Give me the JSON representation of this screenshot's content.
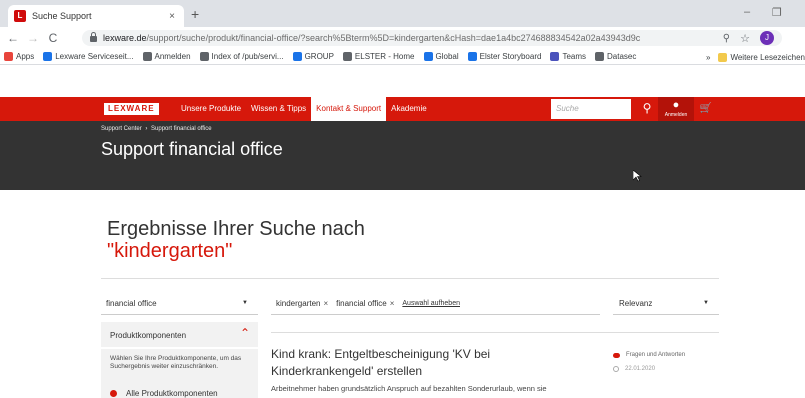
{
  "browser": {
    "tab_title": "Suche Support",
    "tab_close": "×",
    "new_tab": "+",
    "url_host": "lexware.de",
    "url_path": "/support/suche/produkt/financial-office/?search%5Bterm%5D=kindergarten&cHash=dae1a4bc274688834542a02a43943d9c",
    "profile_initial": "J",
    "bookmarks": [
      "Apps",
      "Lexware Serviceseit...",
      "Anmelden",
      "Index of /pub/servi...",
      "GROUP",
      "ELSTER - Home",
      "Global",
      "Elster Storyboard",
      "Teams",
      "Datasec"
    ],
    "bookmarks_more": "»",
    "bookmarks_other": "Weitere Lesezeichen",
    "bookmark_colors": [
      "#e8453c",
      "#1a73e8",
      "#5f6368",
      "#5f6368",
      "#1a73e8",
      "#5f6368",
      "#1a73e8",
      "#1a73e8",
      "#4b53bc",
      "#5f6368"
    ]
  },
  "nav": {
    "logo": "LEXWARE",
    "links": [
      "Unsere Produkte",
      "Wissen & Tipps",
      "Kontakt & Support",
      "Akademie"
    ],
    "active_index": 2,
    "search_placeholder": "Suche",
    "login_label": "Anmelden",
    "brand_color": "#d6180b"
  },
  "hero": {
    "breadcrumb": [
      "Support Center",
      "Support financial office"
    ],
    "breadcrumb_sep": "›",
    "title": "Support financial office"
  },
  "results": {
    "heading": "Ergebnisse Ihrer Suche nach",
    "term": "\"kindergarten\"",
    "product_select": "financial office",
    "panel": {
      "title": "Produktkomponenten",
      "description": "Wählen Sie Ihre Produktkomponente, um das Suchergebnis weiter einzuschränken.",
      "radio_label": "Alle Produktkomponenten"
    },
    "chips": [
      "kindergarten",
      "financial office"
    ],
    "chip_remove": "×",
    "clear_label": "Auswahl aufheben",
    "sort_select": "Relevanz",
    "items": [
      {
        "title": "Kind krank: Entgeltbescheinigung 'KV bei Kinderkrankengeld' erstellen",
        "snippet": "Arbeitnehmer haben grundsätzlich Anspruch auf bezahlten Sonderurlaub, wenn sie",
        "type": "Fragen und Antworten",
        "date": "22.01.2020"
      }
    ]
  }
}
